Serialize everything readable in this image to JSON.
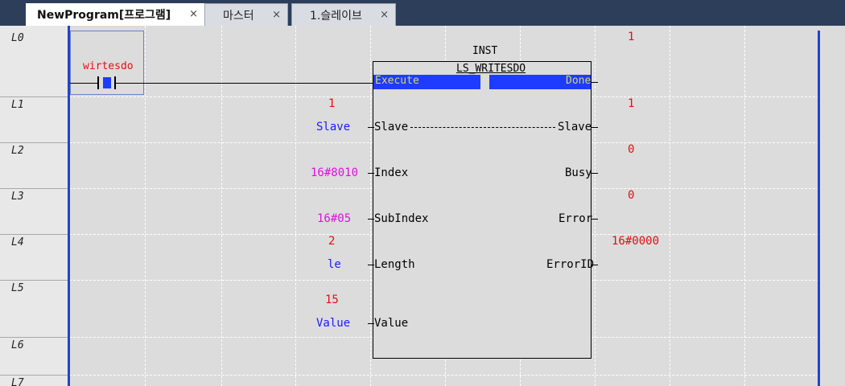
{
  "tabs": [
    {
      "label": "NewProgram[프로그램]",
      "close": "×"
    },
    {
      "label": "마스터",
      "close": "×"
    },
    {
      "label": "1.슬레이브",
      "close": "×"
    }
  ],
  "rows": [
    "L0",
    "L1",
    "L2",
    "L3",
    "L4",
    "L5",
    "L6",
    "L7"
  ],
  "contact": {
    "name": "wirtesdo"
  },
  "function_block": {
    "instance": "INST",
    "type": "LS_WRITESDO",
    "inputs": {
      "execute": "Execute",
      "slave": "Slave",
      "index": "Index",
      "subindex": "SubIndex",
      "length": "Length",
      "value": "Value"
    },
    "outputs": {
      "done": "Done",
      "slave": "Slave",
      "busy": "Busy",
      "error": "Error",
      "errorid": "ErrorID"
    }
  },
  "input_vars": {
    "slave_val": "1",
    "slave_var": "Slave",
    "index_const": "16#8010",
    "subindex_const": "16#05",
    "length_val": "2",
    "length_var": "le",
    "value_val": "15",
    "value_var": "Value"
  },
  "output_vals": {
    "done": "1",
    "slave": "1",
    "busy": "0",
    "error": "0",
    "errorid": "16#0000"
  },
  "colors": {
    "rail": "#2244cc",
    "highlight": "#1e3cff",
    "value": "#e01010",
    "variable": "#1a1aff",
    "constant": "#e010e0"
  }
}
